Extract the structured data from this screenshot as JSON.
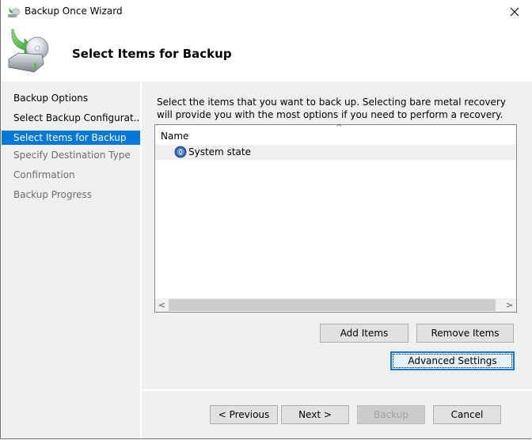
{
  "window": {
    "title": "Backup Once Wizard",
    "app_icon": "backup-wizard-icon",
    "close_icon": "close-icon"
  },
  "header": {
    "title": "Select Items for Backup",
    "icon": "backup-drive-icon"
  },
  "nav": {
    "items": [
      {
        "label": "Backup Options",
        "state": "done"
      },
      {
        "label": "Select Backup Configurat...",
        "state": "done"
      },
      {
        "label": "Select Items for Backup",
        "state": "active"
      },
      {
        "label": "Specify Destination Type",
        "state": "pending"
      },
      {
        "label": "Confirmation",
        "state": "pending"
      },
      {
        "label": "Backup Progress",
        "state": "pending"
      }
    ]
  },
  "content": {
    "description": "Select the items that you want to back up. Selecting bare metal recovery will provide you with the most options if you need to perform a recovery.",
    "list": {
      "column_header": "Name",
      "sort_indicator": "^",
      "rows": [
        {
          "label": "System state",
          "icon": "system-state-icon"
        }
      ]
    },
    "scrollbar": {
      "left_arrow": "<",
      "right_arrow": ">"
    },
    "buttons": {
      "add_items": "Add Items",
      "remove_items": "Remove Items",
      "advanced_settings": "Advanced Settings"
    }
  },
  "footer": {
    "previous": "< Previous",
    "next": "Next >",
    "backup": "Backup",
    "cancel": "Cancel"
  },
  "colors": {
    "accent": "#0078d7",
    "pane_bg": "#f0f0f0",
    "pending_text": "#6d6d6d"
  }
}
